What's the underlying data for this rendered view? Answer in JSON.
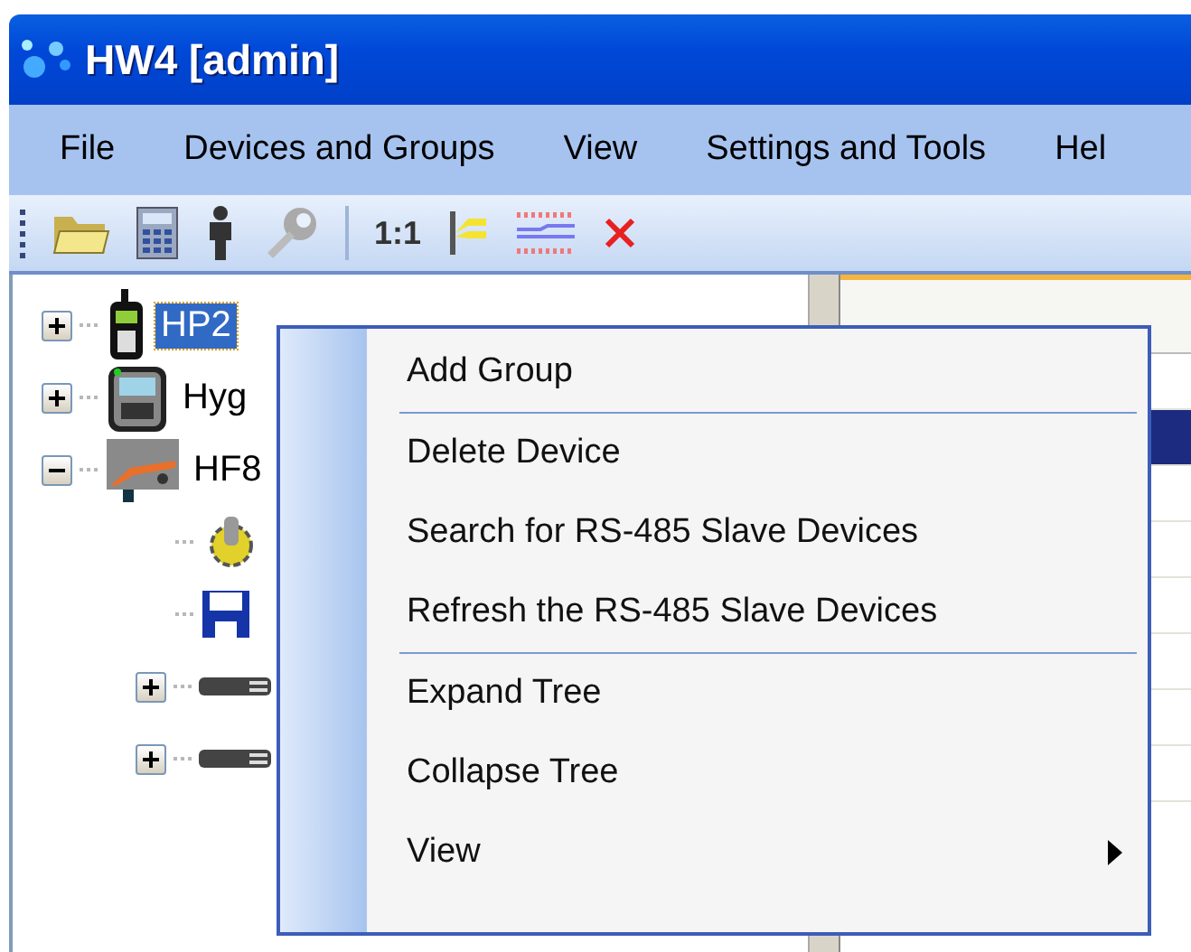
{
  "window": {
    "title": "HW4 [admin]"
  },
  "menu_bar": [
    "File",
    "Devices and Groups",
    "View",
    "Settings and Tools",
    "Hel"
  ],
  "toolbar": {
    "zoom_label": "1:1"
  },
  "tree": [
    {
      "kind": "handheld",
      "label": "HP2",
      "expanded": false,
      "selected": true
    },
    {
      "kind": "meter",
      "label": "Hyg",
      "expanded": false,
      "selected": false
    },
    {
      "kind": "transmitter",
      "label": "HF8",
      "expanded": true,
      "selected": false,
      "children": [
        {
          "kind": "settings"
        },
        {
          "kind": "storage"
        },
        {
          "kind": "probe",
          "expanded": false
        },
        {
          "kind": "probe",
          "expanded": false
        }
      ]
    }
  ],
  "table_rows": [
    {
      "selected": false
    },
    {
      "selected": true
    },
    {
      "selected": false
    },
    {
      "selected": false
    },
    {
      "selected": false
    },
    {
      "selected": false
    },
    {
      "selected": false
    },
    {
      "selected": false
    }
  ],
  "context_menu": [
    {
      "kind": "item",
      "label": "Add Group"
    },
    {
      "kind": "separator"
    },
    {
      "kind": "item",
      "label": "Delete Device"
    },
    {
      "kind": "item",
      "label": "Search for RS-485 Slave Devices"
    },
    {
      "kind": "item",
      "label": "Refresh the RS-485 Slave Devices"
    },
    {
      "kind": "separator"
    },
    {
      "kind": "item",
      "label": "Expand Tree"
    },
    {
      "kind": "item",
      "label": "Collapse Tree"
    },
    {
      "kind": "submenu",
      "label": "View"
    }
  ]
}
